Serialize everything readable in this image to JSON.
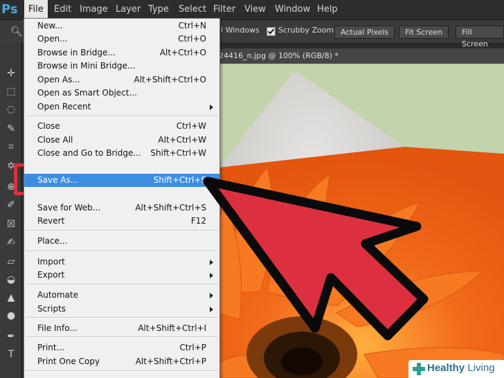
{
  "app": {
    "logo": "Ps"
  },
  "menubar": {
    "items": [
      {
        "label": "File",
        "active": true
      },
      {
        "label": "Edit"
      },
      {
        "label": "Image"
      },
      {
        "label": "Layer"
      },
      {
        "label": "Type"
      },
      {
        "label": "Select"
      },
      {
        "label": "Filter"
      },
      {
        "label": "View"
      },
      {
        "label": "Window"
      },
      {
        "label": "Help"
      }
    ]
  },
  "options": {
    "all_windows_label": "ll Windows",
    "scrubby_zoom_label": "Scrubby Zoom",
    "scrubby_zoom_checked": true,
    "actual_pixels_label": "Actual Pixels",
    "fit_screen_label": "Fit Screen",
    "fill_screen_label": "Fill Screen"
  },
  "document": {
    "tab_label": "24416_n.jpg @ 100% (RGB/8) *"
  },
  "file_menu": {
    "items": [
      {
        "label": "New...",
        "shortcut": "Ctrl+N"
      },
      {
        "label": "Open...",
        "shortcut": "Ctrl+O"
      },
      {
        "label": "Browse in Bridge...",
        "shortcut": "Alt+Ctrl+O"
      },
      {
        "label": "Browse in Mini Bridge...",
        "shortcut": ""
      },
      {
        "label": "Open As...",
        "shortcut": "Alt+Shift+Ctrl+O"
      },
      {
        "label": "Open as Smart Object...",
        "shortcut": ""
      },
      {
        "label": "Open Recent",
        "shortcut": "",
        "submenu": true
      },
      {
        "label": "Close",
        "shortcut": "Ctrl+W"
      },
      {
        "label": "Close All",
        "shortcut": "Alt+Ctrl+W"
      },
      {
        "label": "Close and Go to Bridge...",
        "shortcut": "Shift+Ctrl+W"
      },
      {
        "label": "Save As...",
        "shortcut": "Shift+Ctrl+S",
        "highlighted": true
      },
      {
        "label": "Save for Web...",
        "shortcut": "Alt+Shift+Ctrl+S"
      },
      {
        "label": "Revert",
        "shortcut": "F12"
      },
      {
        "label": "Place...",
        "shortcut": ""
      },
      {
        "label": "Import",
        "shortcut": "",
        "submenu": true
      },
      {
        "label": "Export",
        "shortcut": "",
        "submenu": true
      },
      {
        "label": "Automate",
        "shortcut": "",
        "submenu": true
      },
      {
        "label": "Scripts",
        "shortcut": "",
        "submenu": true
      },
      {
        "label": "File Info...",
        "shortcut": "Alt+Shift+Ctrl+I"
      },
      {
        "label": "Print...",
        "shortcut": "Ctrl+P"
      },
      {
        "label": "Print One Copy",
        "shortcut": "Alt+Shift+Ctrl+P"
      }
    ]
  },
  "tools": [
    "move",
    "marquee",
    "lasso",
    "quick-select",
    "crop",
    "eyedropper",
    "spot-heal",
    "brush",
    "clone-stamp",
    "history-brush",
    "eraser",
    "paint-bucket",
    "blur",
    "dodge",
    "pen",
    "type"
  ],
  "colors": {
    "highlight": "#3c8ee3",
    "annotation": "#d8303e",
    "canvas_bg": "#c3d4ad",
    "petal": "#f26a1b"
  },
  "watermark": {
    "text_bold": "Healthy",
    "text_regular": " Living"
  }
}
